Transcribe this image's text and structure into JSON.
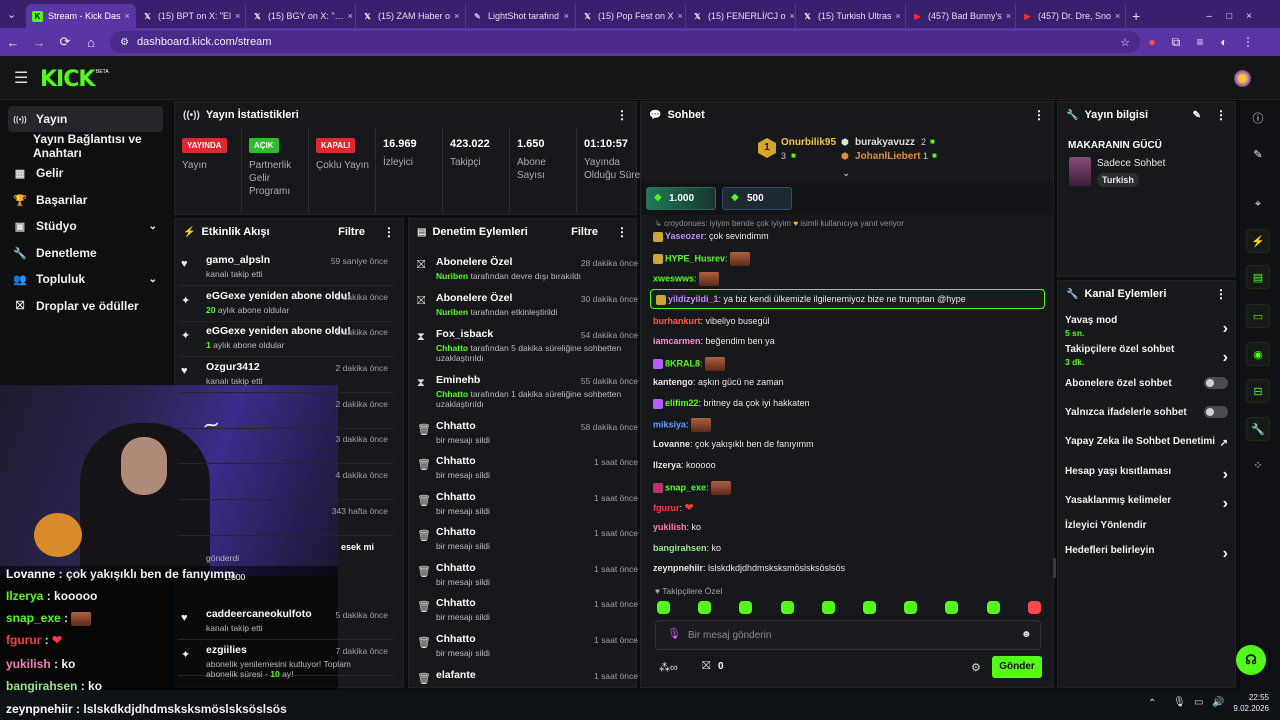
{
  "browser": {
    "tabs": [
      {
        "label": "Stream - Kick Das",
        "icon": "kick-icon",
        "color": "#53fc18",
        "active": true
      },
      {
        "label": "(15) BPT on X: \"El",
        "icon": "x-icon",
        "color": "#ffffff"
      },
      {
        "label": "(15) BGY on X: \"…",
        "icon": "x-icon",
        "color": "#ffffff"
      },
      {
        "label": "(15) ZAM Haber o",
        "icon": "x-icon",
        "color": "#ffffff"
      },
      {
        "label": "LightShot tarafınd",
        "icon": "lightshot-icon",
        "color": "#c9b5f0"
      },
      {
        "label": "(15) Pop Fest on X",
        "icon": "x-icon",
        "color": "#ffffff"
      },
      {
        "label": "(15) FENERLİ/CJ o",
        "icon": "x-icon",
        "color": "#ffffff"
      },
      {
        "label": "(15) Turkish Ultras",
        "icon": "x-icon",
        "color": "#ffffff"
      },
      {
        "label": "(457) Bad Bunny's",
        "icon": "youtube-icon",
        "color": "#ff2b2b"
      },
      {
        "label": "(457) Dr. Dre, Sno",
        "icon": "youtube-icon",
        "color": "#ff2b2b"
      }
    ],
    "new_tab": "+",
    "url": "dashboard.kick.com/stream"
  },
  "kick": {
    "logo": "KICK",
    "beta": "BETA"
  },
  "nav": {
    "items": [
      {
        "label": "Yayın",
        "icon": "broadcast-icon",
        "selected": true
      },
      {
        "label": "Yayın Bağlantısı ve Anahtarı",
        "icon": ""
      },
      {
        "label": "Gelir",
        "icon": "revenue-icon"
      },
      {
        "label": "Başarılar",
        "icon": "trophy-icon"
      },
      {
        "label": "Stüdyo",
        "icon": "studio-icon",
        "chevron": true
      },
      {
        "label": "Denetleme",
        "icon": "wrench-icon"
      },
      {
        "label": "Topluluk",
        "icon": "community-icon",
        "chevron": true
      },
      {
        "label": "Droplar ve ödüller",
        "icon": "drops-icon"
      }
    ]
  },
  "stats": {
    "title": "Yayın İstatistikleri",
    "items": [
      {
        "pill": "YAYINDA",
        "pill_color": "#e0262f",
        "label": "Yayın"
      },
      {
        "pill": "AÇIK",
        "pill_color": "#2bbf2b",
        "label": "Partnerlik Gelir Programı"
      },
      {
        "pill": "KAPALI",
        "pill_color": "#e0262f",
        "label": "Çoklu Yayın"
      },
      {
        "value": "16.969",
        "label": "İzleyici"
      },
      {
        "value": "423.022",
        "label": "Takipçi"
      },
      {
        "value": "1.650",
        "label": "Abone Sayısı"
      },
      {
        "value": "01:10:57",
        "label": "Yayında Olduğu Süre"
      }
    ]
  },
  "activity": {
    "title": "Etkinlik Akışı",
    "filter": "Filtre",
    "rows": [
      {
        "icon": "heart-icon",
        "name": "gamo_alpsln",
        "sub": "kanalı takip etti",
        "time": "59 saniye önce"
      },
      {
        "icon": "sparkle-icon",
        "name": "eGGexe yeniden abone oldu!",
        "sub_num": "20",
        "sub": " aylık abone oldular",
        "time": "1 dakika önce"
      },
      {
        "icon": "sparkle-icon",
        "name": "eGGexe yeniden abone oldu!",
        "sub_num": "1",
        "sub": " aylık abone oldular",
        "time": "1 dakika önce"
      },
      {
        "icon": "heart-icon",
        "name": "Ozgur3412",
        "sub": "kanalı takip etti",
        "time": "2 dakika önce"
      },
      {
        "icon": "",
        "name": "",
        "sub": "",
        "time": "2 dakika önce"
      },
      {
        "icon": "",
        "name": "",
        "sub": "",
        "time": "3 dakika önce"
      },
      {
        "icon": "",
        "name": "",
        "sub": "",
        "time": "4 dakika önce"
      },
      {
        "icon": "",
        "name": "",
        "sub": "",
        "time": "343 hafta önce"
      },
      {
        "icon": "",
        "name": "",
        "sub": "gönderdi",
        "time": ""
      },
      {
        "icon": "heart-icon",
        "name": "caddeercaneokulfoto",
        "sub": "kanalı takip etti",
        "time": "5 dakika önce"
      },
      {
        "icon": "sparkle-icon",
        "name": "ezgiilies",
        "sub": "abonelik yenilemesini kutluyor! Toplam abonelik süresi - ",
        "sub_num2": "10",
        "sub_tail": " ay!",
        "time": "7 dakika önce"
      }
    ],
    "kicks_label": "esek mi",
    "kicks_amount": "1.000"
  },
  "moderation": {
    "title": "Denetim Eylemleri",
    "filter": "Filtre",
    "rows": [
      {
        "icon": "gift-icon",
        "title": "Abonelere Özel",
        "user": "Nuriben",
        "desc": " tarafından devre dışı bırakıldı",
        "time": "28 dakika önce"
      },
      {
        "icon": "gift-icon",
        "title": "Abonelere Özel",
        "user": "Nuriben",
        "desc": " tarafından etkinleştirildi",
        "time": "30 dakika önce"
      },
      {
        "icon": "hourglass-icon",
        "title": "Fox_isback",
        "user": "Chhatto",
        "desc": " tarafından 5 dakika süreliğine sohbetten uzaklaştırıldı",
        "time": "54 dakika önce"
      },
      {
        "icon": "hourglass-icon",
        "title": "Eminehb",
        "user": "Chhatto",
        "desc": " tarafından 1 dakika süreliğine sohbetten uzaklaştırıldı",
        "time": "55 dakika önce"
      },
      {
        "icon": "trash-icon",
        "title": "Chhatto",
        "user": "",
        "desc": "bir mesajı sildi",
        "time": "58 dakika önce"
      },
      {
        "icon": "trash-icon",
        "title": "Chhatto",
        "user": "",
        "desc": "bir mesajı sildi",
        "time": "1 saat önce"
      },
      {
        "icon": "trash-icon",
        "title": "Chhatto",
        "user": "",
        "desc": "bir mesajı sildi",
        "time": "1 saat önce"
      },
      {
        "icon": "trash-icon",
        "title": "Chhatto",
        "user": "",
        "desc": "bir mesajı sildi",
        "time": "1 saat önce"
      },
      {
        "icon": "trash-icon",
        "title": "Chhatto",
        "user": "",
        "desc": "bir mesajı sildi",
        "time": "1 saat önce"
      },
      {
        "icon": "trash-icon",
        "title": "Chhatto",
        "user": "",
        "desc": "bir mesajı sildi",
        "time": "1 saat önce"
      },
      {
        "icon": "trash-icon",
        "title": "Chhatto",
        "user": "",
        "desc": "bir mesajı sildi",
        "time": "1 saat önce"
      },
      {
        "icon": "trash-icon",
        "title": "elafante",
        "user": "",
        "desc": "",
        "time": "1 saat önce"
      }
    ]
  },
  "chat": {
    "title": "Sohbet",
    "leaders": [
      {
        "rank": "1",
        "name": "Onurbilik95",
        "count": "3"
      },
      {
        "name": "burakyavuzz",
        "count": "2"
      },
      {
        "name": "JohanlLiebert",
        "count": "1"
      }
    ],
    "goals": [
      "1.000",
      "500"
    ],
    "reply_hint": "croydonues: iyiyim bende çok iyiyim",
    "reply_hint_tail": "isimli kullanıcıya yanıt veriyor",
    "messages": [
      {
        "user": "Yaseozer",
        "color": "#b98cff",
        "text": "çok sevindimm",
        "badge": "#cfa53a"
      },
      {
        "user": "HYPE_Husrev",
        "color": "#53fc18",
        "text": "",
        "emote": true,
        "badge": "#cfa53a"
      },
      {
        "user": "xweswws",
        "color": "#53fc18",
        "text": "",
        "emote": true
      },
      {
        "user": "yildizyildi_1",
        "color": "#c08cff",
        "text": "ya biz kendi ülkemizle ilgilenemiyoz bize ne trumptan @hype",
        "highlight": true,
        "badge": "#cfa53a"
      },
      {
        "user": "burhankurt",
        "color": "#ff5a4a",
        "text": "vibeliyo busegül"
      },
      {
        "user": "iamcarmen",
        "color": "#ff8ad8",
        "text": "beğendim ben ya"
      },
      {
        "user": "8KRAL8",
        "color": "#53fc18",
        "text": "",
        "emote": true,
        "badge": "#b55cff"
      },
      {
        "user": "kantengo",
        "color": "#e7e7e7",
        "text": "aşkın gücü ne zaman"
      },
      {
        "user": "elifim22",
        "color": "#53fc18",
        "text": "britney da çok iyi hakkaten",
        "badge": "#b55cff"
      },
      {
        "user": "miksiya",
        "color": "#5aa0ff",
        "text": "",
        "emote": true
      },
      {
        "user": "Lovanne",
        "color": "#e7e7e7",
        "text": "çok yakışıklı ben de fanıyımm"
      },
      {
        "user": "Ilzerya",
        "color": "#e7e7e7",
        "text": "kooooo"
      },
      {
        "user": "snap_exe",
        "color": "#53fc18",
        "text": "",
        "emote": true,
        "badge": "#c0306a"
      },
      {
        "user": "fgurur",
        "color": "#ff3b3b",
        "text": "",
        "emoji": "❤"
      },
      {
        "user": "yukilish",
        "color": "#ff7ab8",
        "text": "ko"
      },
      {
        "user": "bangirahsen",
        "color": "#9be58a",
        "text": "ko"
      },
      {
        "user": "zeynpnehiir",
        "color": "#e7e7e7",
        "text": "lslskdkdjdhdmsksksmöslsksöslsös"
      }
    ],
    "followers_only": "Takipçilere Özel",
    "input_placeholder": "Bir mesaj gönderin",
    "kicks_count": "0",
    "send": "Gönder"
  },
  "info": {
    "title": "Yayın bilgisi",
    "stream_title": "MAKARANIN GÜCÜ",
    "category": "Sadece Sohbet",
    "tag": "Turkish"
  },
  "channel_actions": {
    "title": "Kanal Eylemleri",
    "rows": [
      {
        "label": "Yavaş mod",
        "sub": "5 sn.",
        "type": "chevron"
      },
      {
        "label": "Takipçilere özel sohbet",
        "sub": "3 dk.",
        "type": "chevron"
      },
      {
        "label": "Abonelere özel sohbet",
        "type": "toggle"
      },
      {
        "label": "Yalnızca ifadelerle sohbet",
        "type": "toggle"
      },
      {
        "label": "Yapay Zeka ile Sohbet Denetimi",
        "type": "external"
      },
      {
        "label": "Hesap yaşı kısıtlaması",
        "type": "chevron"
      },
      {
        "label": "Yasaklanmış kelimeler",
        "type": "chevron"
      },
      {
        "label": "İzleyici Yönlendir",
        "type": "none"
      },
      {
        "label": "Hedefleri belirleyin",
        "type": "chevron"
      }
    ]
  },
  "overlay_chat": [
    {
      "user": "Lovanne",
      "color": "#ffffff",
      "text": "çok yakışıklı ben de fanıyımm"
    },
    {
      "user": "Ilzerya",
      "color": "#53fc18",
      "text": "kooooo"
    },
    {
      "user": "snap_exe",
      "color": "#53fc18",
      "text": ""
    },
    {
      "user": "fgurur",
      "color": "#ff3b3b",
      "text": ""
    },
    {
      "user": "yukilish",
      "color": "#ff7ab8",
      "text": "ko"
    },
    {
      "user": "bangirahsen",
      "color": "#9be58a",
      "text": "ko"
    },
    {
      "user": "zeynpnehiir",
      "color": "#ffffff",
      "text": "lslskdkdjdhdmsksksmöslsksöslsös"
    }
  ],
  "taskbar": {
    "time": "22:55",
    "date": "9.02.2026"
  }
}
